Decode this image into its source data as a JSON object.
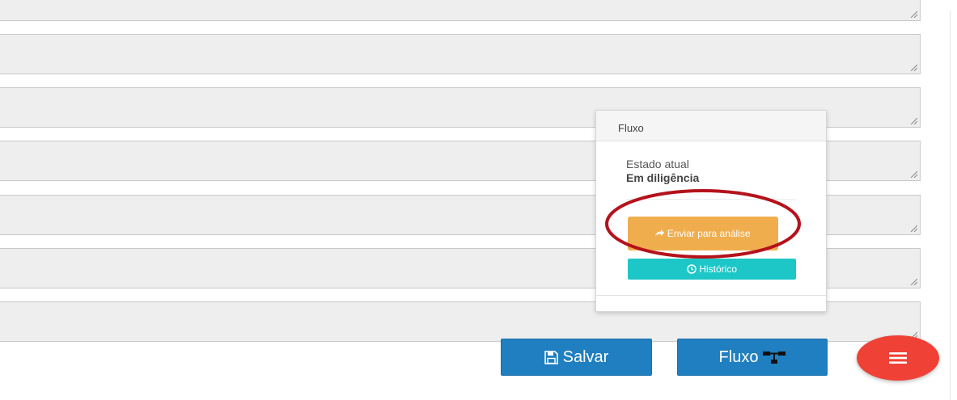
{
  "flow_panel": {
    "title": "Fluxo",
    "state_label": "Estado atual",
    "state_value": "Em diligência",
    "send_button": "Enviar para análise",
    "history_button": "Histórico"
  },
  "footer": {
    "save_label": "Salvar",
    "flow_label": "Fluxo"
  },
  "icons": {
    "send": "share-arrow-icon",
    "history": "clock-icon",
    "save": "floppy-disk-icon",
    "flow": "flow-network-icon",
    "menu": "hamburger-menu-icon"
  },
  "colors": {
    "primary": "#1f7fc0",
    "send_button": "#f0ad4e",
    "history_button": "#1ec7c7",
    "fab": "#ef4136",
    "highlight": "#b5121b"
  }
}
